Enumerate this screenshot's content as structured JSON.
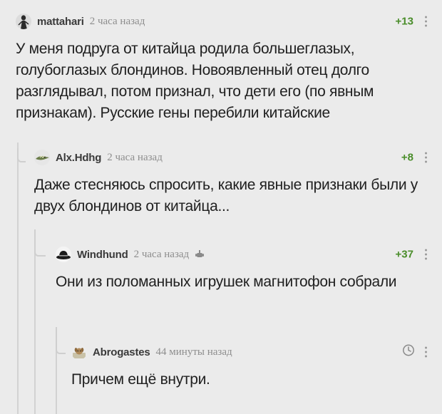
{
  "comments": [
    {
      "username": "mattahari",
      "time": "2 часа назад",
      "rating": "+13",
      "avatar_icon": "woman-figure-avatar",
      "text": "У меня подруга от китайца родила большеглазых, голубоглазых блондинов. Новоявленный отец долго разглядывал, потом признал, что дети его (по явным признакам). Русские гены перебили китайские"
    },
    {
      "username": "Alx.Hdhg",
      "time": "2 часа назад",
      "rating": "+8",
      "avatar_icon": "crocodile-avatar",
      "text": "Даже стесняюсь спросить, какие явные признаки были у двух блондинов от китайца..."
    },
    {
      "username": "Windhund",
      "time": "2 часа назад",
      "rating": "+37",
      "avatar_icon": "hat-avatar",
      "badge_icon": "gamepad-icon",
      "text": "Они из поломанных игрушек магнитофон собрали"
    },
    {
      "username": "Abrogastes",
      "time": "44 минуты назад",
      "avatar_icon": "dog-avatar",
      "rating_icon": "timer-icon",
      "text": "Причем ещё внутри."
    }
  ],
  "colors": {
    "background": "#ebebeb",
    "rating_green": "#4a8d2a",
    "muted_text": "#8d8d8d"
  }
}
